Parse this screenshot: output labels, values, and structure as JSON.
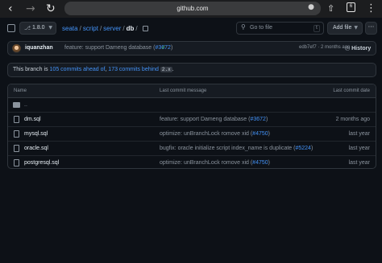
{
  "browser": {
    "url": "github.com",
    "tab_count": "6",
    "back_icon": "chevron-left-icon",
    "forward_icon": "arrow-right-icon",
    "reload_icon": "reload-icon"
  },
  "toolbar": {
    "branch": "1.8.0",
    "breadcrumb": [
      "seata",
      "script",
      "server"
    ],
    "breadcrumb_current": "db",
    "goto_placeholder": "Go to file",
    "goto_key": "t",
    "add_file_label": "Add file",
    "more_label": "···"
  },
  "commit": {
    "author": "iquanzhan",
    "message": "feature: support Dameng database (",
    "pr": "#3672",
    "message_end": ")",
    "sha_time": "edb7ef7 · 2 months ago",
    "history_label": "History"
  },
  "branch_status": {
    "prefix": "This branch is ",
    "ahead": "105 commits ahead of",
    "middle": ", ",
    "behind": "173 commits behind",
    "upstream": "2.x",
    "suffix": "."
  },
  "table": {
    "headers": [
      "Name",
      "Last commit message",
      "Last commit date"
    ],
    "parent_dir": "..",
    "rows": [
      {
        "name": "dm.sql",
        "message": "feature: support Dameng database (",
        "pr": "#3672",
        "message_end": ")",
        "date": "2 months ago"
      },
      {
        "name": "mysql.sql",
        "message": "optimize: unBranchLock romove xid (",
        "pr": "#4750",
        "message_end": ")",
        "date": "last year"
      },
      {
        "name": "oracle.sql",
        "message": "bugfix: oracle initialize script index_name is duplicate (",
        "pr": "#5224",
        "message_end": ")",
        "date": "last year"
      },
      {
        "name": "postgresql.sql",
        "message": "optimize: unBranchLock romove xid (",
        "pr": "#4750",
        "message_end": ")",
        "date": "last year"
      }
    ]
  }
}
